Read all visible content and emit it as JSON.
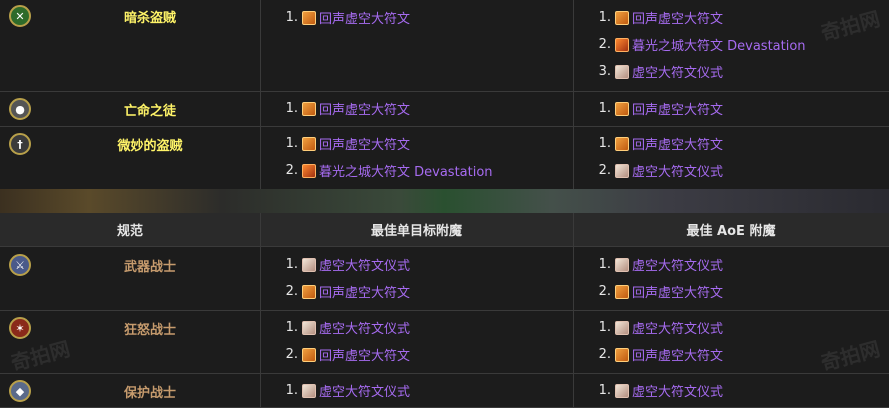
{
  "top_rows": [
    {
      "spec": "暗杀盗贼",
      "icon": "crossed-daggers-icon",
      "class": "rogue",
      "st": [
        {
          "n": "1.",
          "icon": "echo",
          "label": "回声虚空大符文"
        }
      ],
      "aoe": [
        {
          "n": "1.",
          "icon": "echo",
          "label": "回声虚空大符文"
        },
        {
          "n": "2.",
          "icon": "dawn",
          "label": "暮光之城大符文 Devastation"
        },
        {
          "n": "3.",
          "icon": "void",
          "label": "虚空大符文仪式"
        }
      ]
    },
    {
      "spec": "亡命之徒",
      "icon": "pistol-icon",
      "class": "rogue",
      "st": [
        {
          "n": "1.",
          "icon": "echo",
          "label": "回声虚空大符文"
        }
      ],
      "aoe": [
        {
          "n": "1.",
          "icon": "echo",
          "label": "回声虚空大符文"
        }
      ]
    },
    {
      "spec": "微妙的盗贼",
      "icon": "shadow-dagger-icon",
      "class": "rogue",
      "st": [
        {
          "n": "1.",
          "icon": "echo",
          "label": "回声虚空大符文"
        },
        {
          "n": "2.",
          "icon": "dawn",
          "label": "暮光之城大符文 Devastation"
        }
      ],
      "aoe": [
        {
          "n": "1.",
          "icon": "echo",
          "label": "回声虚空大符文"
        },
        {
          "n": "2.",
          "icon": "void",
          "label": "虚空大符文仪式"
        }
      ]
    }
  ],
  "header": {
    "spec": "规范",
    "st": "最佳单目标附魔",
    "aoe": "最佳 AoE 附魔"
  },
  "bottom_rows": [
    {
      "spec": "武器战士",
      "icon": "sword-icon",
      "class": "warrior",
      "st": [
        {
          "n": "1.",
          "icon": "void",
          "label": "虚空大符文仪式"
        },
        {
          "n": "2.",
          "icon": "echo",
          "label": "回声虚空大符文"
        }
      ],
      "aoe": [
        {
          "n": "1.",
          "icon": "void",
          "label": "虚空大符文仪式"
        },
        {
          "n": "2.",
          "icon": "echo",
          "label": "回声虚空大符文"
        }
      ]
    },
    {
      "spec": "狂怒战士",
      "icon": "fury-axe-icon",
      "class": "warrior",
      "st": [
        {
          "n": "1.",
          "icon": "void",
          "label": "虚空大符文仪式"
        },
        {
          "n": "2.",
          "icon": "echo",
          "label": "回声虚空大符文"
        }
      ],
      "aoe": [
        {
          "n": "1.",
          "icon": "void",
          "label": "虚空大符文仪式"
        },
        {
          "n": "2.",
          "icon": "echo",
          "label": "回声虚空大符文"
        }
      ]
    },
    {
      "spec": "保护战士",
      "icon": "shield-icon",
      "class": "warrior",
      "st": [
        {
          "n": "1.",
          "icon": "void",
          "label": "虚空大符文仪式"
        }
      ],
      "aoe": [
        {
          "n": "1.",
          "icon": "void",
          "label": "虚空大符文仪式"
        }
      ]
    }
  ],
  "watermark": "奇拍网",
  "colors": {
    "rogue": "#fff468",
    "warrior": "#c69b6d",
    "link": "#a66bf0"
  }
}
